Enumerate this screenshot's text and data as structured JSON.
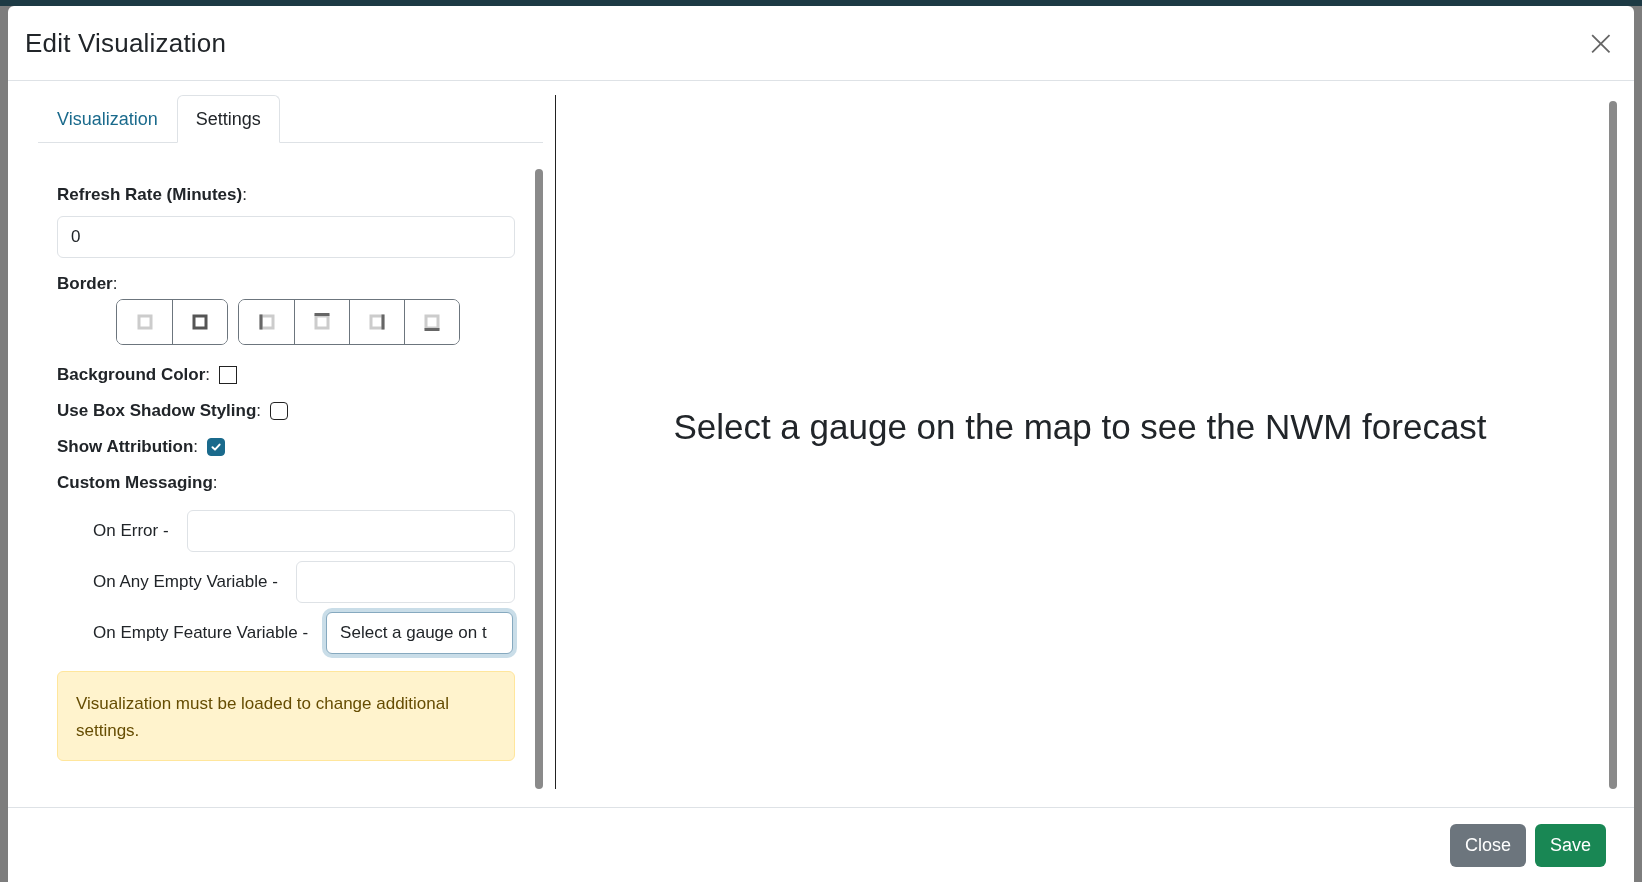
{
  "dialog": {
    "title": "Edit Visualization",
    "close_label": "×"
  },
  "tabs": [
    {
      "label": "Visualization",
      "selected": false
    },
    {
      "label": "Settings",
      "selected": true
    }
  ],
  "settings": {
    "refresh_rate": {
      "label": "**Refresh Rate (Minutes)**:",
      "value": "0"
    },
    "border": {
      "label": "**Border**:"
    },
    "options": [
      {
        "label": "**Background Color**:",
        "kind": "swatch",
        "checked": false
      },
      {
        "label": "**Use Box Shadow Styling**:",
        "kind": "checkbox",
        "checked": false
      },
      {
        "label": "**Show Attribution**:",
        "kind": "checkbox",
        "checked": true
      }
    ],
    "custom_messaging": {
      "label": "**Custom Messaging**:",
      "fields": [
        {
          "label": "On Error -",
          "focused": false
        },
        {
          "label": "On Any Empty Variable -",
          "focused": false
        },
        {
          "label": "On Empty Feature Variable -",
          "value": "Select a gauge on t",
          "focused": true
        }
      ]
    },
    "alert": "Visualization must be loaded to change additional settings."
  },
  "preview": {
    "message": "Select a gauge on the map to see the NWM forecast"
  },
  "footer": {
    "buttons": [
      {
        "label": "Close",
        "kind": "secondary"
      },
      {
        "label": "Save",
        "kind": "primary"
      }
    ]
  }
}
